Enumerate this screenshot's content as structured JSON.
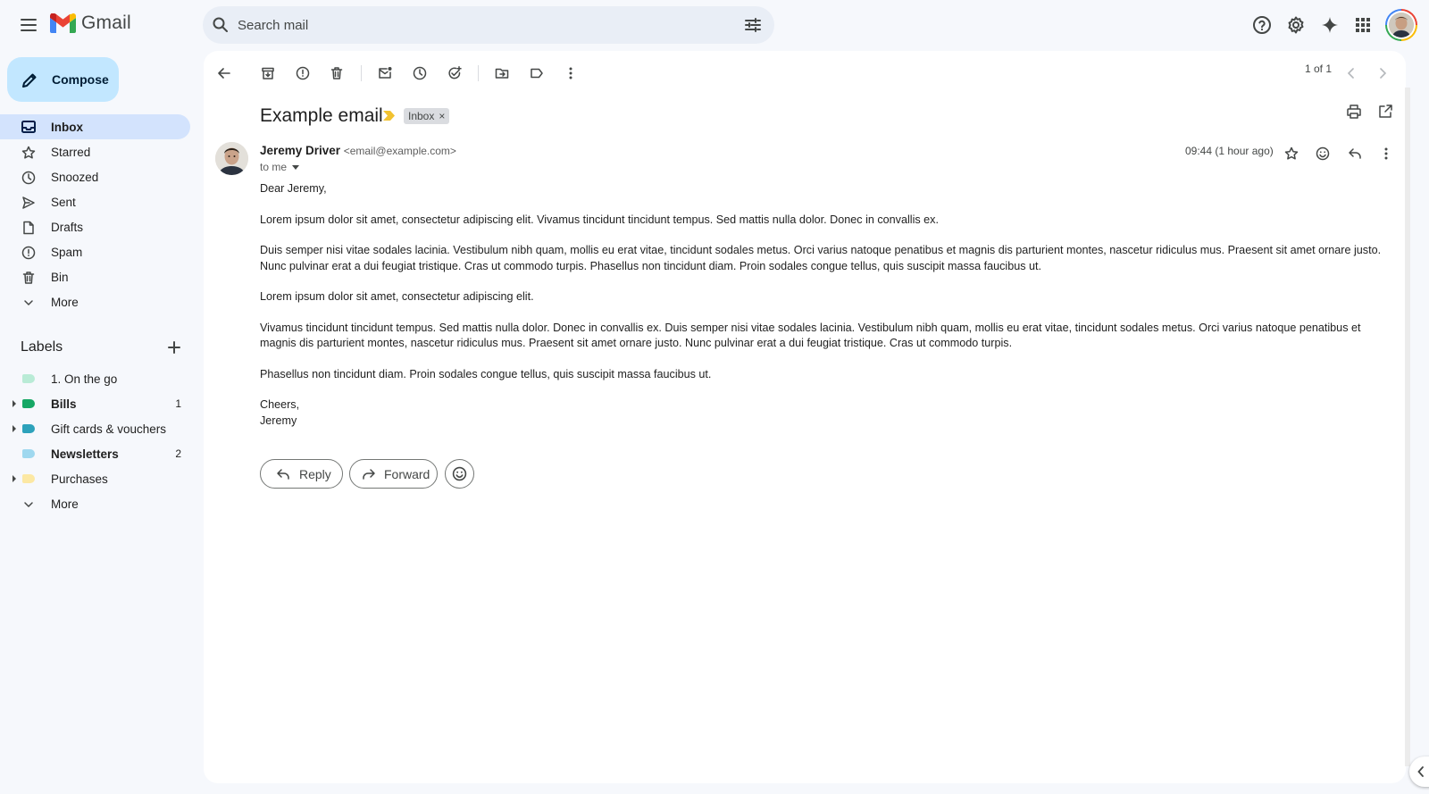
{
  "app": {
    "name": "Gmail"
  },
  "search": {
    "placeholder": "Search mail"
  },
  "compose": {
    "label": "Compose"
  },
  "nav": [
    {
      "label": "Inbox",
      "icon": "inbox-icon",
      "active": true
    },
    {
      "label": "Starred",
      "icon": "star-icon"
    },
    {
      "label": "Snoozed",
      "icon": "clock-icon"
    },
    {
      "label": "Sent",
      "icon": "send-icon"
    },
    {
      "label": "Drafts",
      "icon": "draft-icon"
    },
    {
      "label": "Spam",
      "icon": "spam-icon"
    },
    {
      "label": "Bin",
      "icon": "bin-icon"
    },
    {
      "label": "More",
      "icon": "chevron-down-icon"
    }
  ],
  "labels": {
    "heading": "Labels",
    "items": [
      {
        "label": "1. On the go",
        "color": "#b9ebd6",
        "count": "",
        "bold": false,
        "expandable": false
      },
      {
        "label": "Bills",
        "color": "#16a765",
        "count": "1",
        "bold": true,
        "expandable": true
      },
      {
        "label": "Gift cards & vouchers",
        "color": "#2da2bb",
        "count": "",
        "bold": false,
        "expandable": true
      },
      {
        "label": "Newsletters",
        "color": "#9fd8ef",
        "count": "2",
        "bold": true,
        "expandable": false
      },
      {
        "label": "Purchases",
        "color": "#fce8a3",
        "count": "",
        "bold": false,
        "expandable": true
      }
    ],
    "more": "More"
  },
  "pager": {
    "text": "1 of 1"
  },
  "email": {
    "subject": "Example email",
    "label_chip": "Inbox",
    "label_chip_close": "×",
    "sender_name": "Jeremy Driver",
    "sender_email": "<email@example.com>",
    "to": "to me",
    "timestamp": "09:44 (1 hour ago)",
    "greeting": "Dear Jeremy,",
    "paragraphs": [
      "Lorem ipsum dolor sit amet, consectetur adipiscing elit. Vivamus tincidunt tincidunt tempus. Sed mattis nulla dolor. Donec in convallis ex.",
      "Duis semper nisi vitae sodales lacinia. Vestibulum nibh quam, mollis eu erat vitae, tincidunt sodales metus. Orci varius natoque penatibus et magnis dis parturient montes, nascetur ridiculus mus. Praesent sit amet ornare justo. Nunc pulvinar erat a dui feugiat tristique. Cras ut commodo turpis. Phasellus non tincidunt diam. Proin sodales congue tellus, quis suscipit massa faucibus ut.",
      "Lorem ipsum dolor sit amet, consectetur adipiscing elit.",
      "Vivamus tincidunt tincidunt tempus. Sed mattis nulla dolor. Donec in convallis ex. Duis semper nisi vitae sodales lacinia. Vestibulum nibh quam, mollis eu erat vitae, tincidunt sodales metus. Orci varius natoque penatibus et magnis dis parturient montes, nascetur ridiculus mus. Praesent sit amet ornare justo. Nunc pulvinar erat a dui feugiat tristique. Cras ut commodo turpis.",
      "Phasellus non tincidunt diam. Proin sodales congue tellus, quis suscipit massa faucibus ut."
    ],
    "signoff": "Cheers,",
    "signature": "Jeremy"
  },
  "actions": {
    "reply": "Reply",
    "forward": "Forward"
  }
}
